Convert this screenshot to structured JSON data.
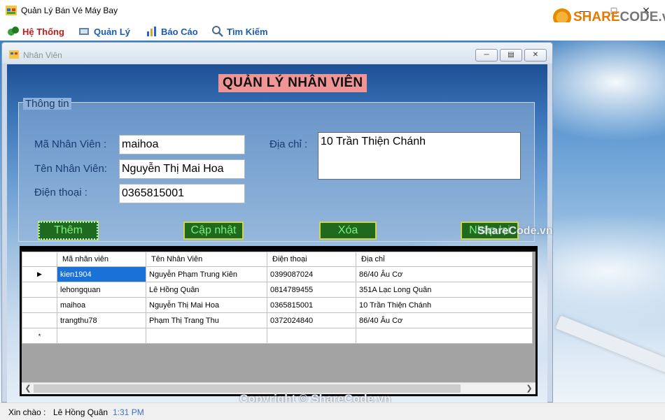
{
  "window": {
    "title": "Quản Lý Bán Vé Máy Bay"
  },
  "menu": [
    {
      "label": "Hệ Thống",
      "icon": "system-icon"
    },
    {
      "label": "Quản Lý",
      "icon": "manage-icon"
    },
    {
      "label": "Báo Cáo",
      "icon": "report-icon"
    },
    {
      "label": "Tìm Kiếm",
      "icon": "search-icon"
    }
  ],
  "child": {
    "title": "Nhân Viên",
    "header": "QUẢN LÝ NHÂN VIÊN",
    "group_title": "Thông tin",
    "labels": {
      "ma": "Mã Nhân Viên :",
      "ten": "Tên Nhân Viên:",
      "dt": "Điện thoại :",
      "dc": "Địa chỉ :"
    },
    "fields": {
      "ma": "maihoa",
      "ten": "Nguyễn Thị Mai Hoa",
      "dt": "0365815001",
      "dc": "10 Trần Thiện Chánh"
    },
    "buttons": {
      "them": "Thêm",
      "capnhat": "Cập nhật",
      "xoa": "Xóa",
      "nhaplai": "Nhập lại"
    }
  },
  "grid": {
    "columns": [
      "Mã nhân viên",
      "Tên Nhân Viên",
      "Điện thoại",
      "Địa chỉ"
    ],
    "rows": [
      [
        "kien1904",
        "Nguyễn Phạm Trung Kiên",
        "0399087024",
        "86/40 Âu Cơ"
      ],
      [
        "lehongquan",
        "Lê Hồng Quân",
        "0814789455",
        "351A Lạc Long Quân"
      ],
      [
        "maihoa",
        "Nguyễn Thị Mai Hoa",
        "0365815001",
        "10 Trần Thiện Chánh"
      ],
      [
        "trangthu78",
        "Phạm Thị Trang Thu",
        "0372024840",
        "86/40 Âu Cơ"
      ]
    ],
    "selected_row": 0,
    "new_row_marker": "*",
    "current_row_marker": "▶"
  },
  "status": {
    "greeting": "Xin chào :",
    "user": "Lê Hồng Quân",
    "time": "1:31 PM"
  },
  "watermarks": {
    "logo_share": "SHARE",
    "logo_code": "CODE.vn",
    "center": "ShareCode.vn",
    "bottom": "Copyright © ShareCode.vn"
  },
  "colors": {
    "menu_first": "#c01a1a",
    "menu": "#1a5bb5",
    "header_bg": "#f09595",
    "button_bg": "#1f6a1f",
    "button_text": "#7cf07c",
    "selection": "#1a72d9",
    "time": "#3a6fcf"
  }
}
